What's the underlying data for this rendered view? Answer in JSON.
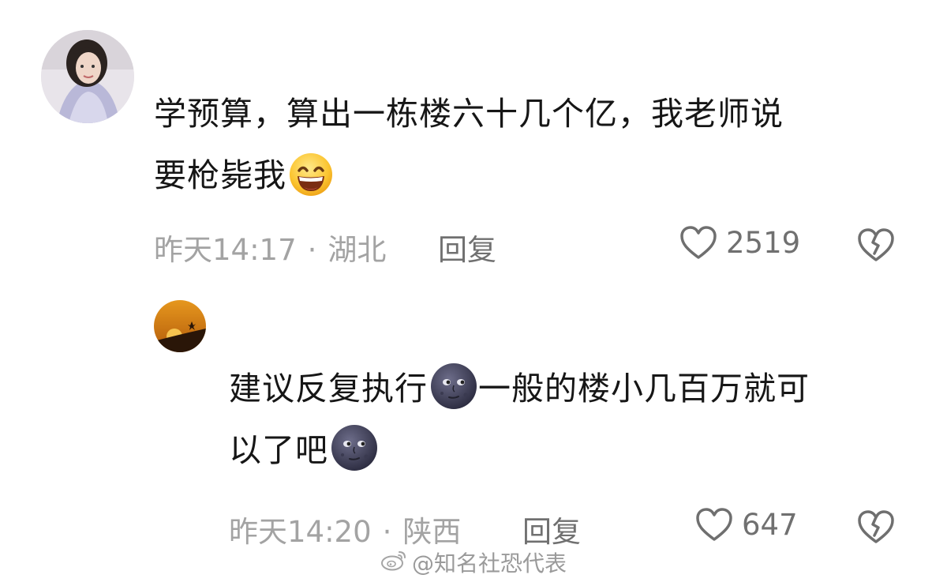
{
  "comments": [
    {
      "line1": "学预算，算出一栋楼六十几个亿，我老师说",
      "line2": "要枪毙我",
      "emoji": "grinning-sweat-emoji",
      "time": "昨天14:17",
      "sep": "·",
      "location": "湖北",
      "reply": "回复",
      "likes": "2519"
    },
    {
      "line1a": "建议反复执行",
      "line1b": "一般的楼小几百万就可",
      "line2": "以了吧",
      "emoji": "new-moon-face-emoji",
      "time": "昨天14:20",
      "sep": "·",
      "location": "陕西",
      "reply": "回复",
      "likes": "647"
    }
  ],
  "watermark": "@知名社恐代表"
}
